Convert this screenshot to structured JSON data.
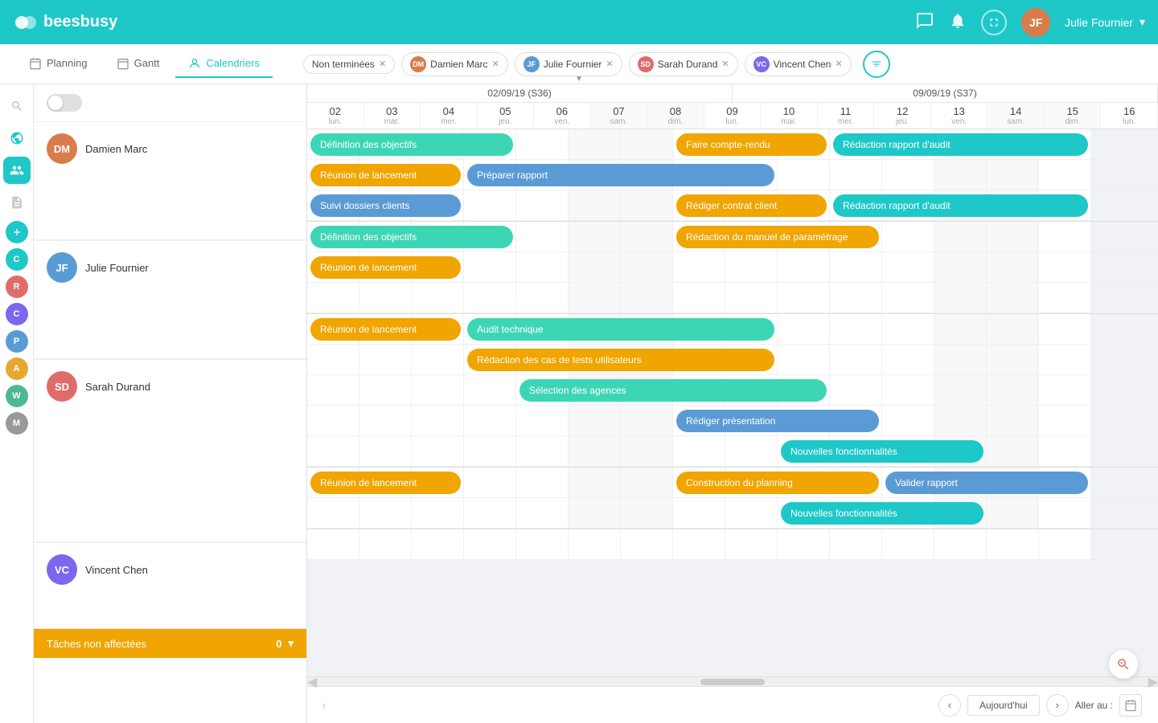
{
  "app": {
    "name": "beesbusy",
    "logo_text": "beesbusy"
  },
  "topnav": {
    "user_name": "Julie Fournier",
    "icons": [
      "chat",
      "bell",
      "fullscreen"
    ]
  },
  "tabs": [
    {
      "id": "planning",
      "label": "Planning",
      "icon": "calendar"
    },
    {
      "id": "gantt",
      "label": "Gantt",
      "icon": "gantt"
    },
    {
      "id": "calendriers",
      "label": "Calendriers",
      "icon": "user",
      "active": true
    }
  ],
  "filters": [
    {
      "id": "non-terminees",
      "label": "Non terminées",
      "has_avatar": false
    },
    {
      "id": "damien-marc",
      "label": "Damien Marc",
      "has_avatar": true,
      "color": "#d97c4b",
      "initials": "DM"
    },
    {
      "id": "julie-fournier",
      "label": "Julie Fournier",
      "has_avatar": true,
      "color": "#5b9bd5",
      "initials": "JF"
    },
    {
      "id": "sarah-durand",
      "label": "Sarah Durand",
      "has_avatar": true,
      "color": "#e06b6b",
      "initials": "SD"
    },
    {
      "id": "vincent-chen",
      "label": "Vincent Chen",
      "has_avatar": true,
      "color": "#7b68ee",
      "initials": "VC"
    }
  ],
  "sidebar_icons": [
    {
      "id": "search",
      "symbol": "🔍"
    },
    {
      "id": "globe",
      "symbol": "🌐"
    },
    {
      "id": "users",
      "symbol": "👥"
    },
    {
      "id": "doc",
      "symbol": "📄"
    },
    {
      "id": "add",
      "symbol": "➕",
      "is_green": true
    },
    {
      "id": "c-badge",
      "letter": "C",
      "color": "#1ec8c8"
    },
    {
      "id": "r-badge",
      "letter": "R",
      "color": "#e06b6b"
    },
    {
      "id": "c-badge2",
      "letter": "C",
      "color": "#7b68ee"
    },
    {
      "id": "p-badge",
      "letter": "P",
      "color": "#5b9bd5"
    },
    {
      "id": "a-badge",
      "letter": "A",
      "color": "#e8a830"
    },
    {
      "id": "w-badge",
      "letter": "W",
      "color": "#4db894"
    },
    {
      "id": "m-badge",
      "letter": "M",
      "color": "#666"
    }
  ],
  "resources": [
    {
      "id": "damien-marc",
      "name": "Damien Marc",
      "initials": "DM",
      "color": "#d97c4b"
    },
    {
      "id": "julie-fournier",
      "name": "Julie Fournier",
      "initials": "JF",
      "color": "#5b9bd5"
    },
    {
      "id": "sarah-durand",
      "name": "Sarah Durand",
      "initials": "SD",
      "color": "#e06b6b"
    },
    {
      "id": "vincent-chen",
      "name": "Vincent Chen",
      "initials": "VC",
      "color": "#7b68ee"
    }
  ],
  "unassigned": {
    "label": "Tâches non affectées",
    "count": "0"
  },
  "weeks": [
    {
      "label": "02/09/19 (S36)"
    },
    {
      "label": "09/09/19 (S37)"
    }
  ],
  "days": [
    {
      "num": "02",
      "name": "lun.",
      "weekend": false
    },
    {
      "num": "03",
      "name": "mar.",
      "weekend": false
    },
    {
      "num": "04",
      "name": "mer.",
      "weekend": false
    },
    {
      "num": "05",
      "name": "jeu.",
      "weekend": false
    },
    {
      "num": "06",
      "name": "ven.",
      "weekend": false
    },
    {
      "num": "07",
      "name": "sam.",
      "weekend": true
    },
    {
      "num": "08",
      "name": "dim.",
      "weekend": true
    },
    {
      "num": "09",
      "name": "lun.",
      "weekend": false
    },
    {
      "num": "10",
      "name": "mar.",
      "weekend": false
    },
    {
      "num": "11",
      "name": "mer.",
      "weekend": false
    },
    {
      "num": "12",
      "name": "jeu.",
      "weekend": false
    },
    {
      "num": "13",
      "name": "ven.",
      "weekend": false
    },
    {
      "num": "14",
      "name": "sam.",
      "weekend": true
    },
    {
      "num": "15",
      "name": "dim.",
      "weekend": true
    },
    {
      "num": "16",
      "name": "lun.",
      "weekend": false
    }
  ],
  "tasks": {
    "damien_marc": [
      {
        "label": "Définition des objectifs",
        "start": 0,
        "end": 4,
        "color": "task-green",
        "row": 0
      },
      {
        "label": "Faire compte-rendu",
        "start": 7,
        "end": 10,
        "color": "task-yellow",
        "row": 0
      },
      {
        "label": "Rédaction rapport d'audit",
        "start": 10,
        "end": 15,
        "color": "task-teal",
        "row": 0
      },
      {
        "label": "Réunion de lancement",
        "start": 0,
        "end": 3,
        "color": "task-yellow",
        "row": 1
      },
      {
        "label": "Préparer rapport",
        "start": 3,
        "end": 9,
        "color": "task-blue",
        "row": 1
      },
      {
        "label": "Suivi dossiers clients",
        "start": 0,
        "end": 3,
        "color": "task-blue",
        "row": 2
      },
      {
        "label": "Rédiger contrat client",
        "start": 7,
        "end": 10,
        "color": "task-yellow",
        "row": 2
      },
      {
        "label": "Rédaction rapport d'audit",
        "start": 10,
        "end": 15,
        "color": "task-teal",
        "row": 2
      }
    ],
    "julie_fournier": [
      {
        "label": "Définition des objectifs",
        "start": 0,
        "end": 4,
        "color": "task-green",
        "row": 0
      },
      {
        "label": "Rédaction du manuel de paramétrage",
        "start": 7,
        "end": 11,
        "color": "task-yellow",
        "row": 0
      },
      {
        "label": "Réunion de lancement",
        "start": 0,
        "end": 3,
        "color": "task-yellow",
        "row": 1
      }
    ],
    "sarah_durand": [
      {
        "label": "Réunion de lancement",
        "start": 0,
        "end": 3,
        "color": "task-yellow",
        "row": 0
      },
      {
        "label": "Audit technique",
        "start": 3,
        "end": 9,
        "color": "task-green",
        "row": 0
      },
      {
        "label": "Rédaction des cas de tests utilisateurs",
        "start": 3,
        "end": 9,
        "color": "task-yellow",
        "row": 1
      },
      {
        "label": "Sélection des agences",
        "start": 4,
        "end": 10,
        "color": "task-green",
        "row": 2
      },
      {
        "label": "Rédiger présentation",
        "start": 7,
        "end": 11,
        "color": "task-blue",
        "row": 3
      },
      {
        "label": "Nouvelles fonctionnalités",
        "start": 9,
        "end": 13,
        "color": "task-teal",
        "row": 4
      }
    ],
    "vincent_chen": [
      {
        "label": "Réunion de lancement",
        "start": 0,
        "end": 3,
        "color": "task-yellow",
        "row": 0
      },
      {
        "label": "Construction du planning",
        "start": 7,
        "end": 11,
        "color": "task-yellow",
        "row": 0
      },
      {
        "label": "Valider rapport",
        "start": 11,
        "end": 15,
        "color": "task-blue",
        "row": 0
      },
      {
        "label": "Nouvelles fonctionnalités",
        "start": 9,
        "end": 13,
        "color": "task-teal",
        "row": 1
      }
    ]
  },
  "bottom": {
    "today_label": "Aujourd'hui",
    "goto_label": "Aller au :"
  }
}
